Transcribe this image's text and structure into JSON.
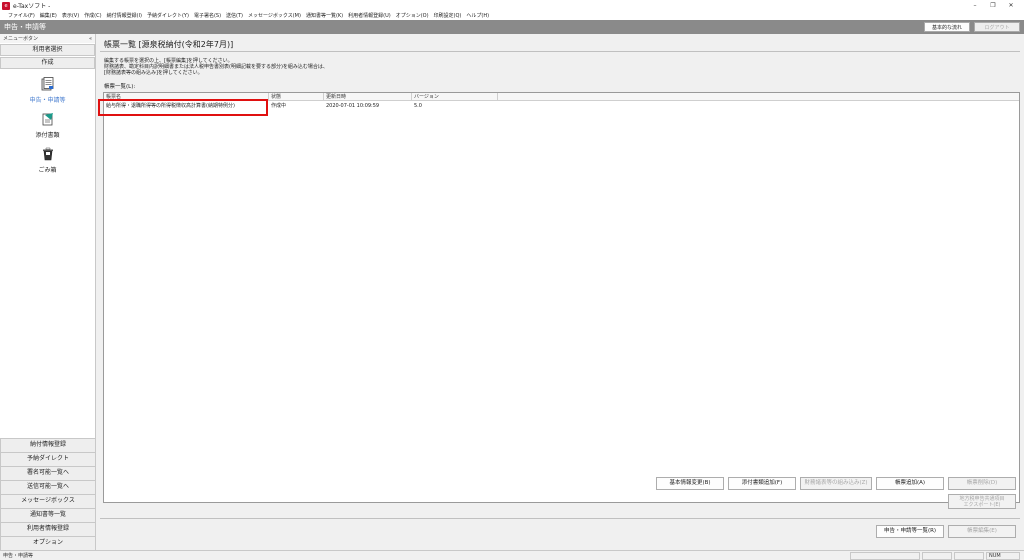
{
  "window": {
    "title": "e-Taxソフト - ",
    "minimize": "–",
    "restore": "❐",
    "close": "✕"
  },
  "menu": [
    "ファイル(F)",
    "編集(E)",
    "表示(V)",
    "作成(C)",
    "納付情報登録(I)",
    "予納ダイレクト(Y)",
    "電子署名(S)",
    "送信(T)",
    "メッセージボックス(M)",
    "通知書等一覧(K)",
    "利用者情報登録(U)",
    "オプション(O)",
    "印刷設定(Q)",
    "ヘルプ(H)"
  ],
  "header": {
    "mode_title": "申告・申請等",
    "basic_flow_button": "基本的な流れ",
    "logout_button": "ログアウト"
  },
  "sidebar": {
    "menu_label": "メニューボタン",
    "collapse": "«",
    "user_select": "利用者選択",
    "create": "作成",
    "icons": [
      {
        "label": "申告・申請等",
        "icon": "documents-icon"
      },
      {
        "label": "添付書類",
        "icon": "attachment-icon"
      },
      {
        "label": "ごみ箱",
        "icon": "trash-icon"
      }
    ],
    "bottom_items": [
      "納付情報登録",
      "予納ダイレクト",
      "署名可能一覧へ",
      "送信可能一覧へ",
      "メッセージボックス",
      "通知書等一覧",
      "利用者情報登録",
      "オプション"
    ]
  },
  "main": {
    "page_title": "帳票一覧 [源泉税納付(令和2年7月)]",
    "instructions": [
      "編集する帳票を選択の上、[帳票編集]を押してください。",
      "財務諸表、勘定科目内訳明細書または法人税申告書別表(明細記載を要する部分)を組み込む場合は、",
      "[財務諸表等の組み込み]を押してください。"
    ],
    "list_label": "帳票一覧(L):",
    "columns": [
      "帳票名",
      "状態",
      "更新日時",
      "バージョン"
    ],
    "rows": [
      {
        "name": "給与所得・退職所得等の所得税徴収高計算書(納期特例分)",
        "state": "作成中",
        "updated": "2020-07-01 10:09:59",
        "version": "5.0"
      }
    ],
    "buttons": {
      "basic_info_change": "基本情報変更(B)",
      "attach_doc_add": "添付書類追加(F)",
      "financial_import": "財務諸表等の組み込み(Z)",
      "form_add": "帳票追加(A)",
      "form_delete": "帳票削除(D)",
      "local_tax_export_1": "地方税申告共通項目",
      "local_tax_export_2": "エクスポート(E)",
      "submission_list": "申告・申請等一覧(R)",
      "form_edit": "帳票編集(E)"
    }
  },
  "status": {
    "text": "申告・申請等",
    "num": "NUM"
  }
}
